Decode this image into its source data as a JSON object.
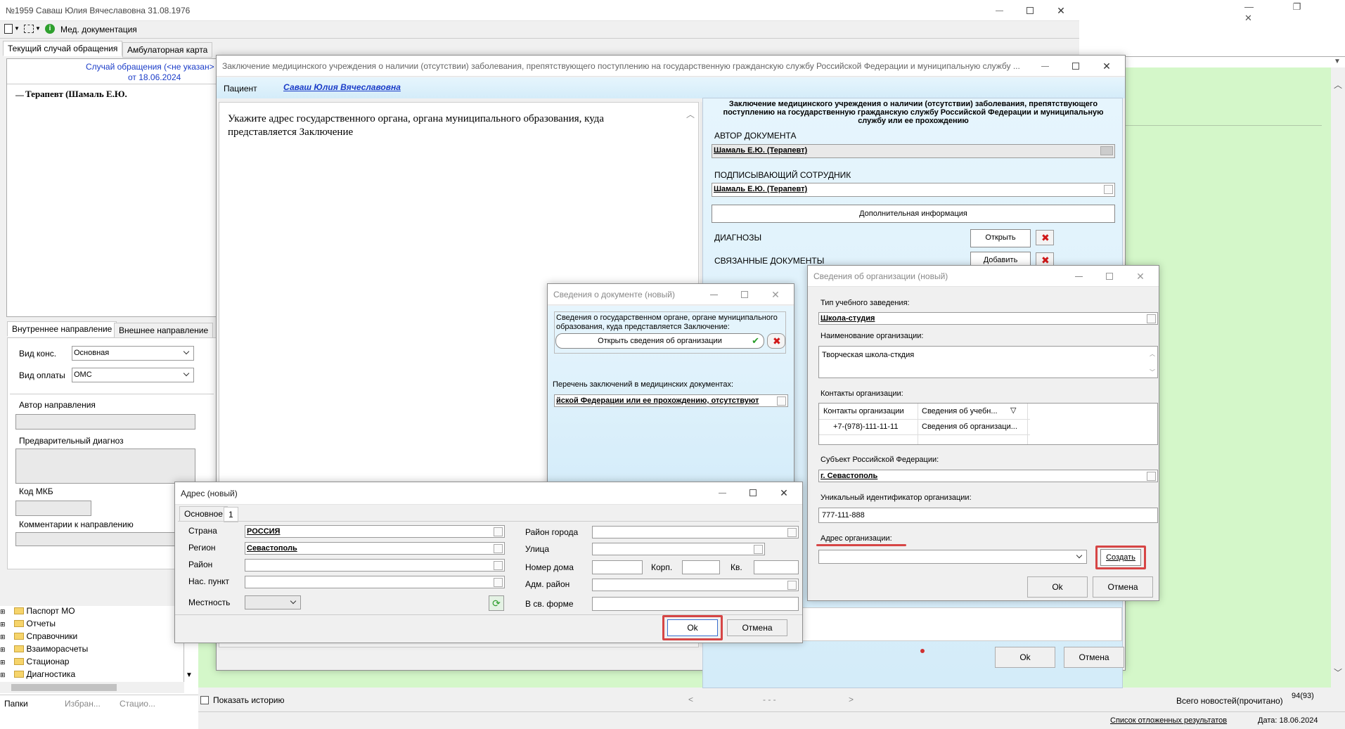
{
  "main_window": {
    "title": "№1959 Саваш Юлия Вячеславовна 31.08.1976",
    "toolbar_med_docs": "Мед. документация",
    "tabs": [
      "Текущий случай обращения",
      "Амбулаторная карта"
    ],
    "case_header_line1": "Случай обращения (<не указан>",
    "case_header_line2": "от 18.06.2024",
    "tree_doctor": "Терапевт (Шамаль Е.Ю.",
    "direction_tabs": [
      "Внутреннее направление",
      "Внешнее направление"
    ],
    "vid_kons_label": "Вид конс.",
    "vid_kons_value": "Основная",
    "vid_oplaty_label": "Вид оплаты",
    "vid_oplaty_value": "ОМС",
    "author_direction_label": "Автор направления",
    "prelim_diag_label": "Предварительный диагноз",
    "mkb_label": "Код МКБ",
    "comments_label": "Комментарии к направлению"
  },
  "left_tree": {
    "items": [
      "Паспорт МО",
      "Отчеты",
      "Справочники",
      "Взаиморасчеты",
      "Стационар",
      "Диагностика"
    ],
    "bottom_tabs": [
      "Папки",
      "Избран...",
      "Стацио..."
    ]
  },
  "status_bar": {
    "show_history": "Показать историю",
    "pager": "- - -",
    "news": "Всего новостей(прочитано)",
    "news_count": "94(93)",
    "deferred": "Список отложенных результатов",
    "date": "Дата: 18.06.2024"
  },
  "conclusion_window": {
    "title": "Заключение медицинского учреждения о наличии (отсутствии) заболевания, препятствующего поступлению на государственную гражданскую службу Российской Федерации и муниципальную службу ...",
    "patient_label": "Пациент",
    "patient_name": "Саваш Юлия Вячеславовна",
    "instruction": "Укажите адрес государственного органа, органа муниципального образования, куда представляется Заключение",
    "panel_title": "Заключение медицинского учреждения о наличии (отсутствии) заболевания, препятствующего поступлению на государственную гражданскую службу Российской Федерации и муниципальную службу или ее прохождению",
    "author_label": "АВТОР ДОКУМЕНТА",
    "author_value": "Шамаль Е.Ю. (Терапевт)",
    "signer_label": "ПОДПИСЫВАЮЩИЙ СОТРУДНИК",
    "signer_value": "Шамаль Е.Ю. (Терапевт)",
    "extra_info_button": "Дополнительная информация",
    "diagnoses_label": "ДИАГНОЗЫ",
    "open_button": "Открыть",
    "related_docs_label": "СВЯЗАННЫЕ ДОКУМЕНТЫ",
    "add_button": "Добавить",
    "ok_button": "Ok",
    "cancel_button": "Отмена"
  },
  "doc_info_window": {
    "title": "Сведения о документе (новый)",
    "description": "Сведения о государственном органе, органе муниципального образования, куда представляется Заключение:",
    "open_org_button": "Открыть сведения об организации",
    "list_label": "Перечень заключений в медицинских документах:",
    "list_value": "йской Федерации или ее прохождению, отсутствуют"
  },
  "org_window": {
    "title": "Сведения об организации (новый)",
    "school_type_label": "Тип учебного заведения:",
    "school_type_value": "Школа-студия",
    "org_name_label": "Наименование организации:",
    "org_name_value": "Творческая школа-сткдия",
    "contacts_label": "Контакты организации:",
    "contacts_header_col1": "Контакты организации",
    "contacts_header_col2": "Сведения об учебн...",
    "contacts_row_phone": "+7-(978)-111-11-11",
    "contacts_row_info": "Сведения об организаци...",
    "subject_label": "Субъект Российской Федерации:",
    "subject_value": "г. Севастополь",
    "uid_label": "Уникальный идентификатор организации:",
    "uid_value": "777-111-888",
    "address_label": "Адрес организации:",
    "create_link": "Создать",
    "ok_button": "Ok",
    "cancel_button": "Отмена"
  },
  "address_window": {
    "title": "Адрес (новый)",
    "tabs": [
      "Основное",
      "1"
    ],
    "country_label": "Страна",
    "country_value": "РОССИЯ",
    "region_label": "Регион",
    "region_value": "Севастополь",
    "district_label": "Район",
    "settlement_label": "Нас. пункт",
    "locality_label": "Местность",
    "city_district_label": "Район города",
    "street_label": "Улица",
    "house_label": "Номер дома",
    "korp_label": "Корп.",
    "kv_label": "Кв.",
    "adm_district_label": "Адм. район",
    "free_form_label": "В св. форме",
    "ok_button": "Ok",
    "cancel_button": "Отмена"
  },
  "colors": {
    "highlight_red": "#d64545",
    "link_blue": "#1a3cc8",
    "green_bg": "#d4f7c9"
  }
}
